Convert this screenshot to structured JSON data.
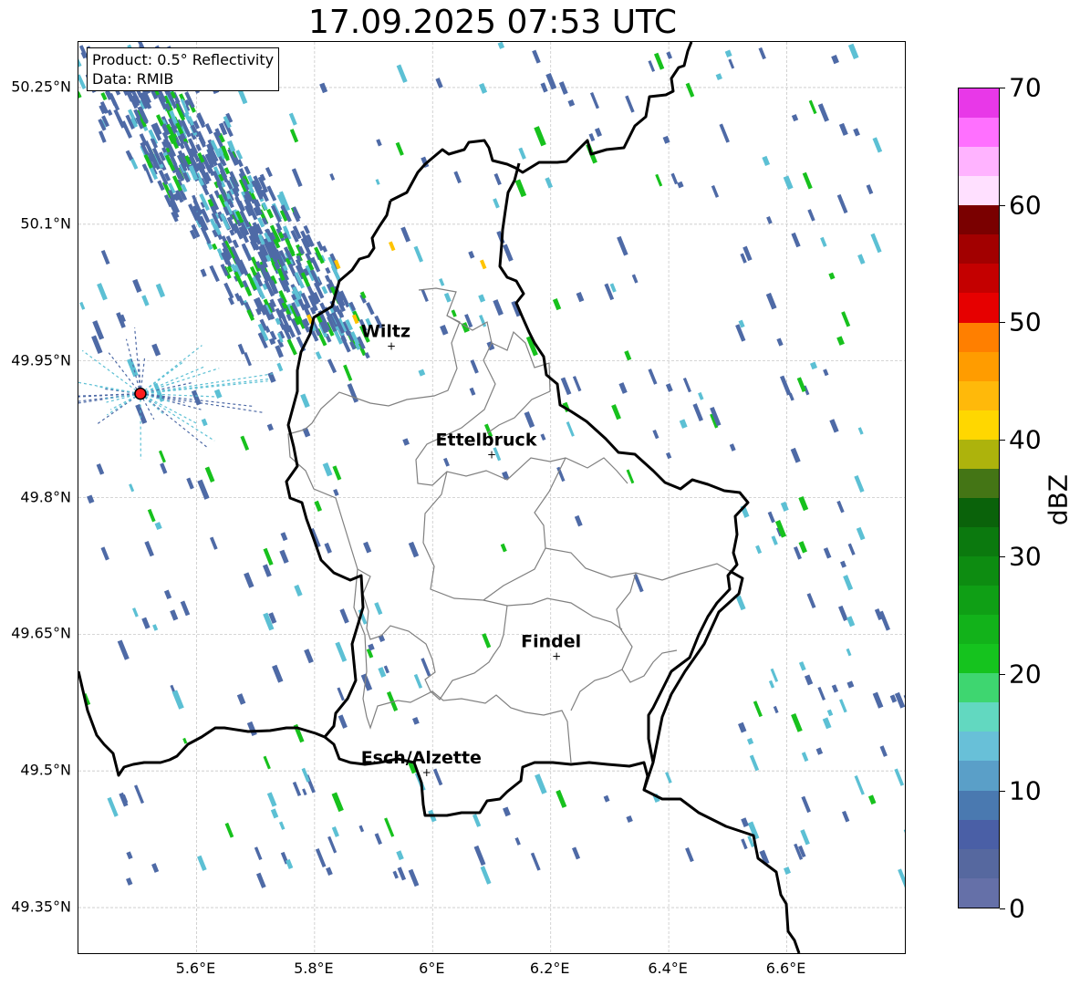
{
  "title": "17.09.2025 07:53 UTC",
  "info": {
    "product": "Product: 0.5° Reflectivity",
    "data_source": "Data: RMIB"
  },
  "map_extent": {
    "lon_min": 5.4,
    "lon_max": 6.8,
    "lat_min": 49.3,
    "lat_max": 50.3
  },
  "lat_ticks": [
    {
      "value": 50.25,
      "label": "50.25°N"
    },
    {
      "value": 50.1,
      "label": "50.1°N"
    },
    {
      "value": 49.95,
      "label": "49.95°N"
    },
    {
      "value": 49.8,
      "label": "49.8°N"
    },
    {
      "value": 49.65,
      "label": "49.65°N"
    },
    {
      "value": 49.5,
      "label": "49.5°N"
    },
    {
      "value": 49.35,
      "label": "49.35°N"
    }
  ],
  "lon_ticks": [
    {
      "value": 5.6,
      "label": "5.6°E"
    },
    {
      "value": 5.8,
      "label": "5.8°E"
    },
    {
      "value": 6.0,
      "label": "6°E"
    },
    {
      "value": 6.2,
      "label": "6.2°E"
    },
    {
      "value": 6.4,
      "label": "6.4°E"
    },
    {
      "value": 6.6,
      "label": "6.6°E"
    }
  ],
  "cities": [
    {
      "name": "Wiltz",
      "lon": 5.93,
      "lat": 49.966
    },
    {
      "name": "Ettelbruck",
      "lon": 6.1,
      "lat": 49.847
    },
    {
      "name": "Findel",
      "lon": 6.21,
      "lat": 49.626
    },
    {
      "name": "Esch/Alzette",
      "lon": 5.99,
      "lat": 49.498
    }
  ],
  "radar_site": {
    "lon": 5.505,
    "lat": 49.914
  },
  "colorbar": {
    "label": "dBZ",
    "min": 0,
    "max": 70,
    "ticks": [
      "0",
      "10",
      "20",
      "30",
      "40",
      "50",
      "60",
      "70"
    ],
    "colors": [
      "#6570a8",
      "#56689f",
      "#4a5fa6",
      "#4a79b0",
      "#5a9fc8",
      "#68c0d8",
      "#62d8c0",
      "#3ed670",
      "#15c31e",
      "#12b21a",
      "#0f9f15",
      "#0d8c11",
      "#0b790e",
      "#0a620a",
      "#447515",
      "#adb30c",
      "#ffd700",
      "#ffb90a",
      "#ff9c00",
      "#ff7f00",
      "#e60000",
      "#c40000",
      "#a20000",
      "#7a0000",
      "#ffe0ff",
      "#ffb3ff",
      "#ff70ff",
      "#e838e8"
    ]
  },
  "echo_colors": {
    "light": "#4e6aa6",
    "cyan": "#5cc0d4",
    "green": "#17c11d",
    "yellow": "#ffc400",
    "radar_marker": "#ff1e1e"
  }
}
